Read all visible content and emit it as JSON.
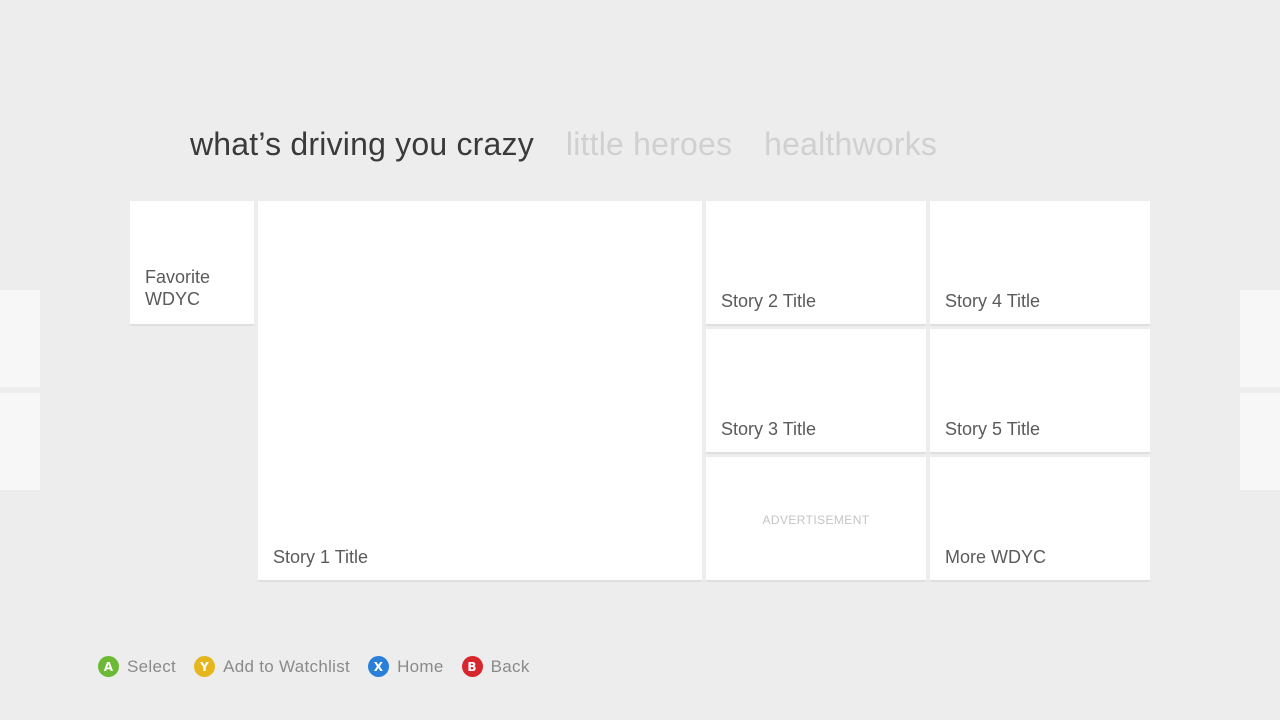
{
  "pivots": [
    {
      "label": "what’s driving you crazy",
      "active": true
    },
    {
      "label": "little heroes",
      "active": false
    },
    {
      "label": "healthworks",
      "active": false
    }
  ],
  "tiles": {
    "favorite": "Favorite WDYC",
    "story1": "Story 1 Title",
    "story2": "Story 2 Title",
    "story3": "Story 3 Title",
    "story4": "Story 4 Title",
    "story5": "Story 5 Title",
    "advertisement": "ADVERTISEMENT",
    "more": "More WDYC"
  },
  "legend": [
    {
      "button": "A",
      "label": "Select",
      "color": "#6bb935",
      "icon": "a-button-icon"
    },
    {
      "button": "Y",
      "label": "Add to Watchlist",
      "color": "#e5b61e",
      "icon": "y-button-icon"
    },
    {
      "button": "X",
      "label": "Home",
      "color": "#2a7fd8",
      "icon": "x-button-icon"
    },
    {
      "button": "B",
      "label": "Back",
      "color": "#d7262c",
      "icon": "b-button-icon"
    }
  ],
  "colors": {
    "background": "#ededed",
    "tile": "#ffffff",
    "active_pivot": "#3a3a3a",
    "inactive_pivot": "#d0d0d0"
  }
}
